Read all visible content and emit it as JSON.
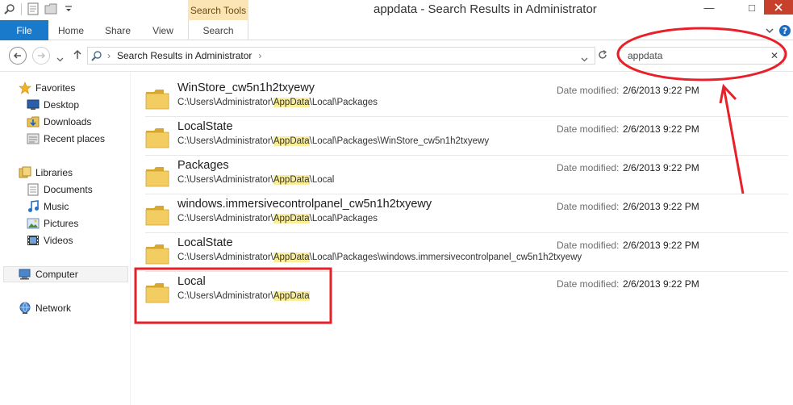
{
  "window": {
    "title": "appdata - Search Results in Administrator",
    "context_tab": "Search Tools",
    "minimize_glyph": "—",
    "maximize_glyph": "□"
  },
  "ribbon": {
    "tabs": [
      "File",
      "Home",
      "Share",
      "View",
      "Search"
    ]
  },
  "address": {
    "path": "Search Results in Administrator",
    "separator": "›"
  },
  "search": {
    "value": "appdata",
    "clear_glyph": "✕"
  },
  "nav": {
    "favorites": "Favorites",
    "desktop": "Desktop",
    "downloads": "Downloads",
    "recent": "Recent places",
    "libraries": "Libraries",
    "documents": "Documents",
    "music": "Music",
    "pictures": "Pictures",
    "videos": "Videos",
    "computer": "Computer",
    "network": "Network"
  },
  "results": [
    {
      "name": "WinStore_cw5n1h2txyewy",
      "path_pre": "C:\\Users\\Administrator\\",
      "path_hl": "AppData",
      "path_post": "\\Local\\Packages",
      "date_label": "Date modified:",
      "date": "2/6/2013 9:22 PM"
    },
    {
      "name": "LocalState",
      "path_pre": "C:\\Users\\Administrator\\",
      "path_hl": "AppData",
      "path_post": "\\Local\\Packages\\WinStore_cw5n1h2txyewy",
      "date_label": "Date modified:",
      "date": "2/6/2013 9:22 PM"
    },
    {
      "name": "Packages",
      "path_pre": "C:\\Users\\Administrator\\",
      "path_hl": "AppData",
      "path_post": "\\Local",
      "date_label": "Date modified:",
      "date": "2/6/2013 9:22 PM"
    },
    {
      "name": "windows.immersivecontrolpanel_cw5n1h2txyewy",
      "path_pre": "C:\\Users\\Administrator\\",
      "path_hl": "AppData",
      "path_post": "\\Local\\Packages",
      "date_label": "Date modified:",
      "date": "2/6/2013 9:22 PM"
    },
    {
      "name": "LocalState",
      "path_pre": "C:\\Users\\Administrator\\",
      "path_hl": "AppData",
      "path_post": "\\Local\\Packages\\windows.immersivecontrolpanel_cw5n1h2txyewy",
      "date_label": "Date modified:",
      "date": "2/6/2013 9:22 PM"
    },
    {
      "name": "Local",
      "path_pre": "C:\\Users\\Administrator\\",
      "path_hl": "AppData",
      "path_post": "",
      "date_label": "Date modified:",
      "date": "2/6/2013 9:22 PM"
    }
  ],
  "colors": {
    "file_tab": "#1979ca",
    "context_tab": "#fbe5b5",
    "highlight": "#fbee97",
    "annotation": "#e8202a"
  }
}
